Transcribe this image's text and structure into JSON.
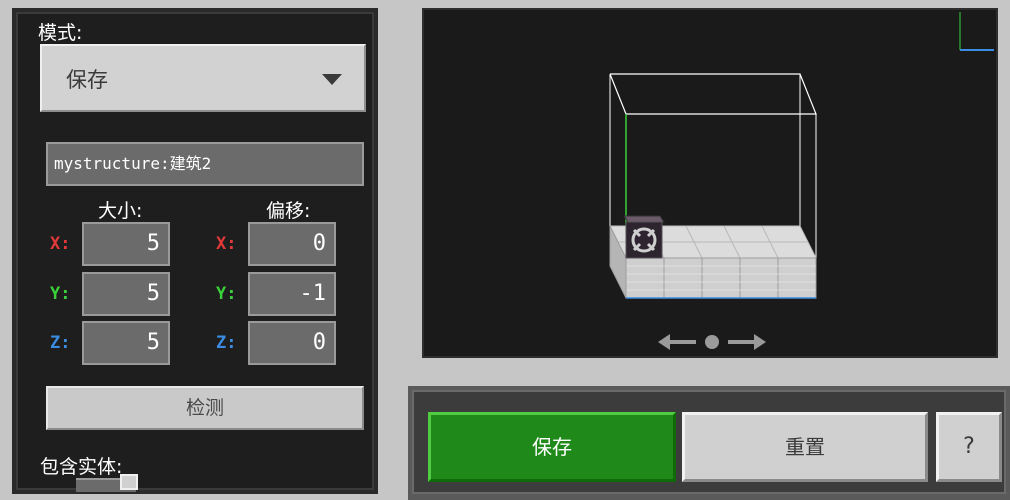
{
  "left_panel": {
    "mode_label": "模式:",
    "mode_value": "保存",
    "name_value": "mystructure:建筑2",
    "size_heading": "大小:",
    "offset_heading": "偏移:",
    "size": {
      "x_label": "X:",
      "x_value": "5",
      "y_label": "Y:",
      "y_value": "5",
      "z_label": "Z:",
      "z_value": "5"
    },
    "offset": {
      "x_label": "X:",
      "x_value": "0",
      "y_label": "Y:",
      "y_value": "-1",
      "z_label": "Z:",
      "z_value": "0"
    },
    "detect_label": "检测",
    "include_entities_label": "包含实体:"
  },
  "bottom_bar": {
    "save_label": "保存",
    "reset_label": "重置",
    "help_label": "?"
  },
  "colors": {
    "axis_x": "#e23a3a",
    "axis_y": "#3ad13a",
    "axis_z": "#3a8de2",
    "save_green": "#1f8a1a"
  },
  "icons": {
    "dropdown": "chevron-down-icon",
    "rotate_control": "rotate-arrows-icon",
    "structure_block": "structure-block-icon"
  }
}
